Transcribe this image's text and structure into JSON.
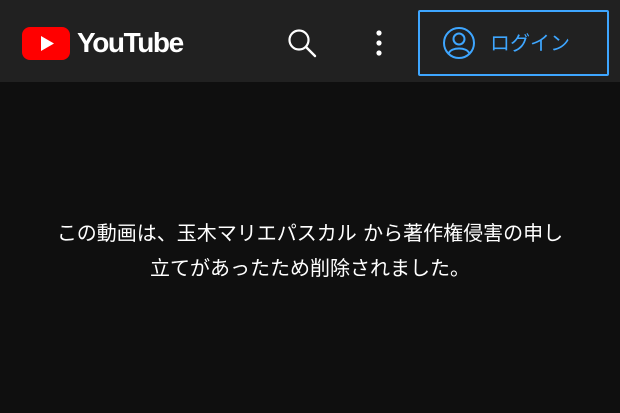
{
  "header": {
    "logo_text": "YouTube",
    "icons": {
      "search": "search-icon",
      "more": "more-vertical-icon",
      "account": "account-circle-icon"
    },
    "login_label": "ログイン"
  },
  "notice": {
    "line1": "この動画は、玉木マリエパスカル から著作権侵害の申し",
    "line2": "立てがあったため削除されました。"
  },
  "colors": {
    "background": "#0f0f0f",
    "header_background": "#212121",
    "brand_red": "#ff0000",
    "link_blue": "#3ea6ff",
    "text": "#ffffff"
  }
}
